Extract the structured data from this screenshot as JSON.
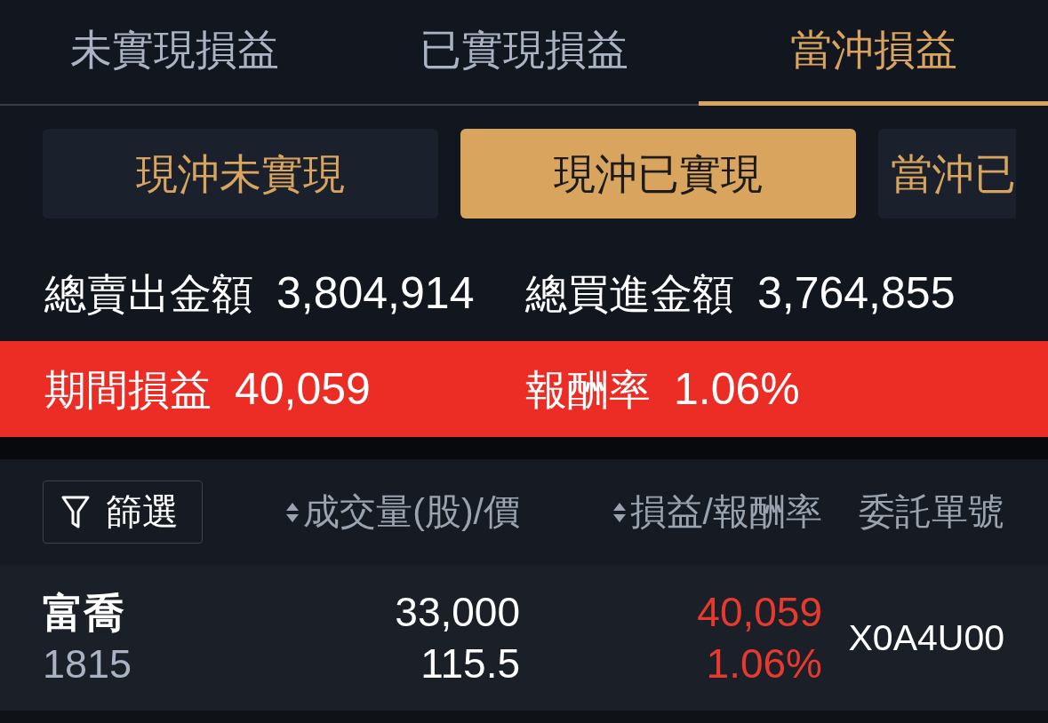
{
  "tabs": [
    {
      "label": "未實現損益",
      "selected": false
    },
    {
      "label": "已實現損益",
      "selected": false
    },
    {
      "label": "當沖損益",
      "selected": true
    }
  ],
  "sub_tabs": [
    {
      "label": "現沖未實現",
      "selected": false
    },
    {
      "label": "現沖已實現",
      "selected": true
    },
    {
      "label": "當沖已",
      "selected": false
    }
  ],
  "summary": [
    {
      "label": "總賣出金額",
      "value": "3,804,914"
    },
    {
      "label": "總買進金額",
      "value": "3,764,855"
    }
  ],
  "result": [
    {
      "label": "期間損益",
      "value": "40,059"
    },
    {
      "label": "報酬率",
      "value": "1.06%"
    }
  ],
  "filter_button": {
    "label": "篩選"
  },
  "columns": [
    {
      "label": "成交量(股)/價",
      "sortable": true
    },
    {
      "label": "損益/報酬率",
      "sortable": true
    },
    {
      "label": "委託單號",
      "sortable": false
    }
  ],
  "rows": [
    {
      "name": "富喬",
      "code": "1815",
      "volume": "33,000",
      "price": "115.5",
      "pnl": "40,059",
      "return": "1.06%",
      "order_no": "X0A4U00"
    }
  ]
}
